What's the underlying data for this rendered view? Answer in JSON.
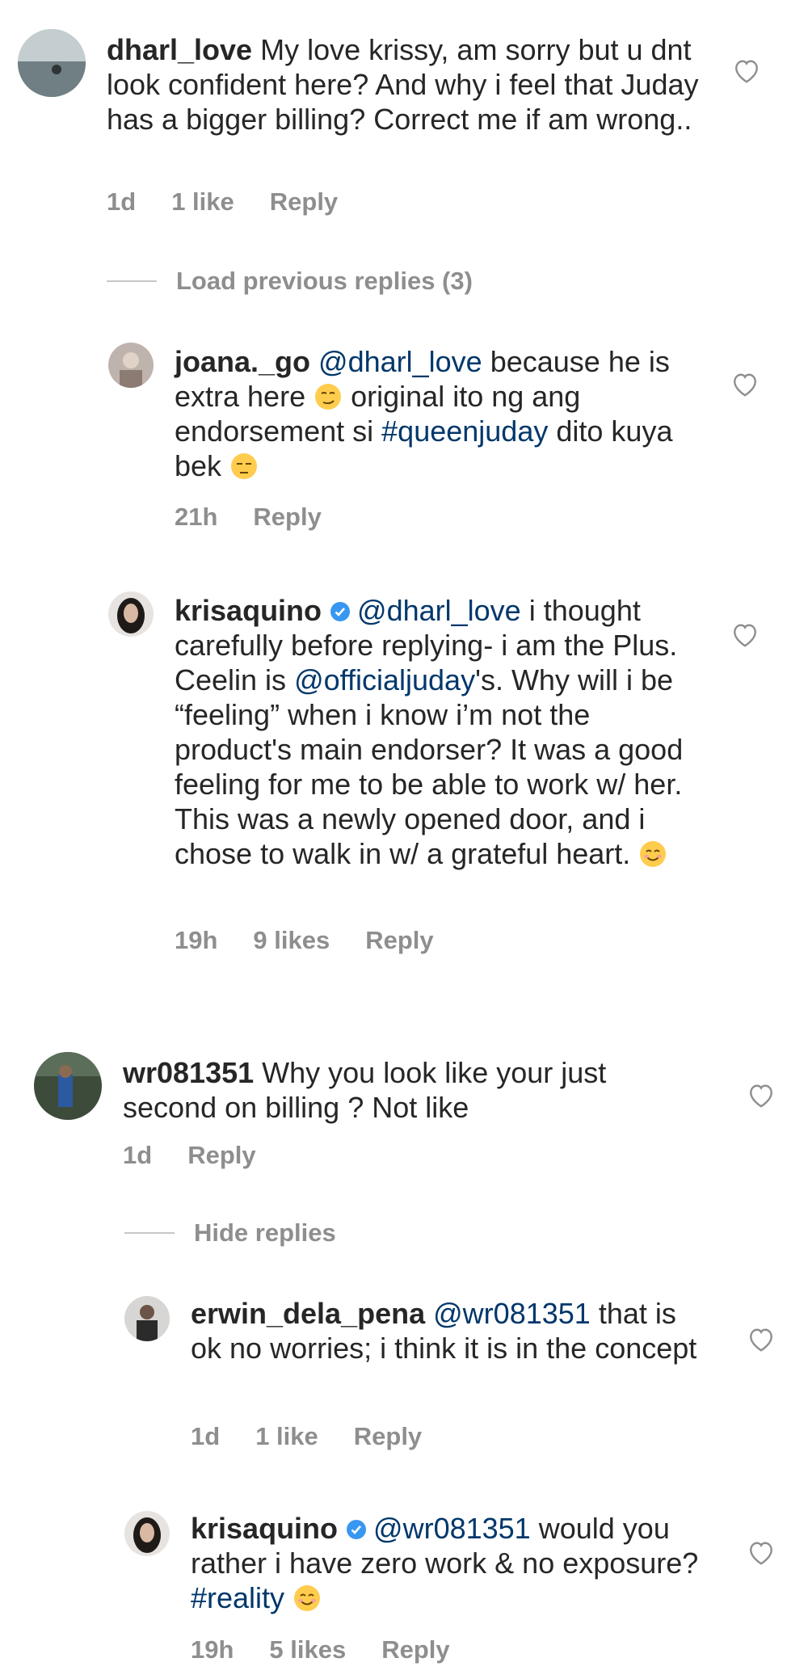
{
  "comments": [
    {
      "username": "dharl_love",
      "text": "My love krissy, am sorry but u dnt look confident here? And why i feel that Juday has a bigger billing? Correct me if am wrong..",
      "time": "1d",
      "likes": "1 like",
      "reply": "Reply",
      "load_previous": "Load previous replies (3)",
      "replies": [
        {
          "username": "joana._go",
          "mention": "@dharl_love",
          "text_a": "because he is extra here",
          "text_b": "original ito ng ang endorsement si",
          "hashtag": "#queenjuday",
          "text_c": "dito kuya bek",
          "time": "21h",
          "reply": "Reply"
        },
        {
          "username": "krisaquino",
          "mention": "@dharl_love",
          "text_a": "i thought carefully before replying- i am the Plus. Ceelin is",
          "mention2": "@officialjuday",
          "text_b": "'s. Why will i be “feeling” when i know i’m not the product's main endorser? It was a good feeling for me to be able to work w/ her. This was a newly opened door, and i chose to walk in w/ a grateful heart.",
          "time": "19h",
          "likes": "9 likes",
          "reply": "Reply"
        }
      ]
    },
    {
      "username": "wr081351",
      "text": "Why you look like your just second on billing ? Not like",
      "time": "1d",
      "reply": "Reply",
      "hide_replies": "Hide replies",
      "replies": [
        {
          "username": "erwin_dela_pena",
          "mention": "@wr081351",
          "text": "that is ok no worries; i think it is in the concept",
          "time": "1d",
          "likes": "1 like",
          "reply": "Reply"
        },
        {
          "username": "krisaquino",
          "mention": "@wr081351",
          "text_a": "would you rather i have zero work & no exposure?",
          "hashtag": "#reality",
          "time": "19h",
          "likes": "5 likes",
          "reply": "Reply"
        }
      ]
    }
  ],
  "icons": {
    "like": "heart-outline-icon",
    "verified": "verified-badge-icon"
  },
  "colors": {
    "text": "#262626",
    "secondary": "#8e8e8e",
    "link": "#00376b",
    "verified": "#3897f0"
  }
}
